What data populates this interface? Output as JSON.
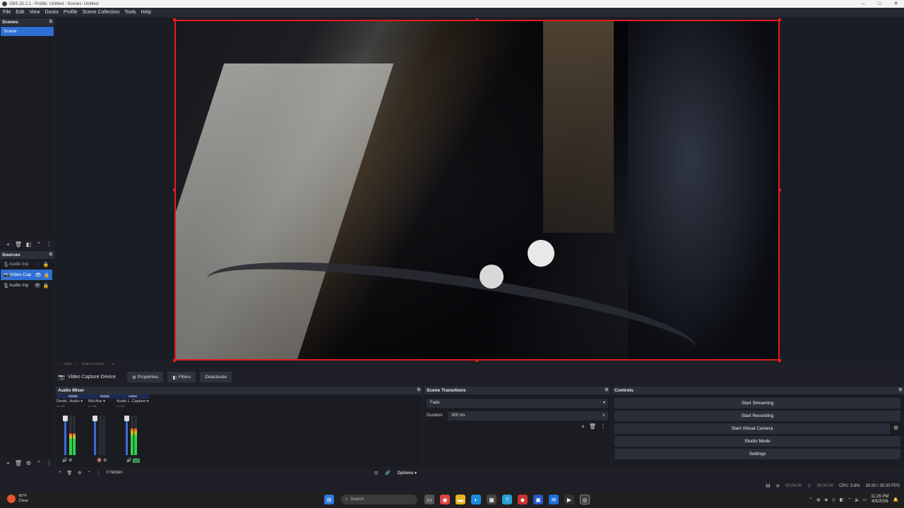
{
  "window": {
    "title": "OBS 32.2.1 - Profile: Untitled - Scenes: Untitled",
    "controls": [
      "–",
      "□",
      "✕"
    ]
  },
  "menu": [
    "File",
    "Edit",
    "View",
    "Docks",
    "Profile",
    "Scene Collection",
    "Tools",
    "Help"
  ],
  "scenes": {
    "header": "Scenes",
    "items": [
      "Scene"
    ]
  },
  "sources": {
    "header": "Sources",
    "items": [
      {
        "label": "Audio Inp",
        "icon": "mic-icon"
      },
      {
        "label": "Video Cap",
        "icon": "camera-icon"
      },
      {
        "label": "Audio Inp",
        "icon": "mic-icon"
      }
    ]
  },
  "zoom": {
    "minus": "–",
    "value": "100%",
    "plus": "+",
    "scale_label": "Scale to window"
  },
  "source_bar": {
    "name": "Video Capture Device",
    "properties": "Properties",
    "filters": "Filters",
    "deactivate": "Deactivate"
  },
  "mixer": {
    "header": "Audio Mixer",
    "channels": [
      {
        "tag": "Global",
        "name": "Deskt...Audio",
        "db": "0.0 dB",
        "level": 0.55
      },
      {
        "tag": "Global",
        "name": "Mic/Aux",
        "db": "0.0 dB",
        "level": 0.0
      },
      {
        "tag": "Active",
        "name": "Audio I...Capture",
        "db": "0.0 dB",
        "level": 0.68
      }
    ],
    "hidden": "0 hidden",
    "options": "Options"
  },
  "transitions": {
    "header": "Scene Transitions",
    "selected": "Fade",
    "duration_label": "Duration",
    "duration": "300 ms"
  },
  "controls": {
    "header": "Controls",
    "buttons": [
      "Start Streaming",
      "Start Recording",
      "Start Virtual Camera",
      "Studio Mode",
      "Settings"
    ]
  },
  "status": {
    "stream_time": "00:00:00",
    "rec_time": "00:00:00",
    "cpu": "CPU: 3.6%",
    "fps": "30.00 / 30.00 FPS"
  },
  "taskbar": {
    "weather_temp": "60°F",
    "weather_desc": "Clear",
    "search": "Search",
    "time": "11:26 PM",
    "date": "8/5/2026"
  },
  "colors": {
    "accent": "#2f6fd3",
    "selection": "#e21c1c",
    "background": "#1e1f26"
  }
}
